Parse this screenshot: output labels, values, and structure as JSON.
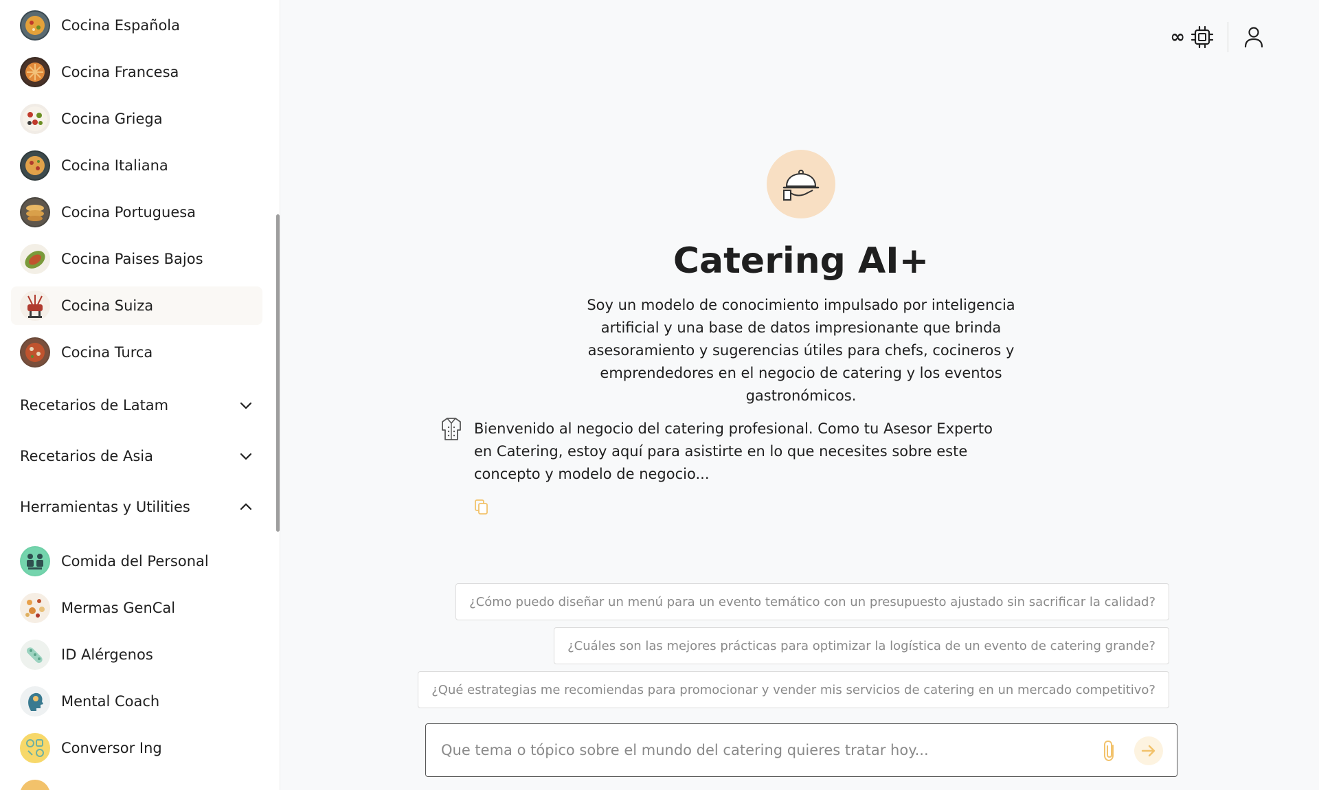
{
  "sidebar": {
    "cuisines": [
      {
        "label": "Cocina Española",
        "icon": "paella-dish-icon"
      },
      {
        "label": "Cocina Francesa",
        "icon": "tart-dish-icon"
      },
      {
        "label": "Cocina Griega",
        "icon": "greek-salad-icon"
      },
      {
        "label": "Cocina Italiana",
        "icon": "pizza-dish-icon"
      },
      {
        "label": "Cocina Portuguesa",
        "icon": "pastel-de-nata-icon"
      },
      {
        "label": "Cocina Paises Bajos",
        "icon": "dutch-dish-icon"
      },
      {
        "label": "Cocina Suiza",
        "icon": "fondue-pot-icon",
        "active": true
      },
      {
        "label": "Cocina Turca",
        "icon": "turkish-dish-icon"
      }
    ],
    "sections": [
      {
        "label": "Recetarios de Latam",
        "expanded": false
      },
      {
        "label": "Recetarios de Asia",
        "expanded": false
      },
      {
        "label": "Herramientas y Utilities",
        "expanded": true
      }
    ],
    "tools": [
      {
        "label": "Comida del Personal",
        "icon": "staff-meal-icon"
      },
      {
        "label": "Mermas GenCal",
        "icon": "waste-calculator-icon"
      },
      {
        "label": "ID Alérgenos",
        "icon": "allergen-id-icon"
      },
      {
        "label": "Mental Coach",
        "icon": "mental-coach-icon"
      },
      {
        "label": "Conversor Ing",
        "icon": "ingredient-converter-icon"
      }
    ]
  },
  "topbar": {
    "infinity_label": "∞",
    "icons": [
      "infinity-icon",
      "cpu-chip-icon",
      "user-profile-icon"
    ]
  },
  "hero": {
    "title": "Catering AI+",
    "description": "Soy un modelo de conocimiento impulsado por inteligencia artificial y una base de datos impresionante que brinda asesoramiento y sugerencias útiles para chefs, cocineros y emprendedores en el negocio de catering y los eventos gastronómicos."
  },
  "message": {
    "text": "Bienvenido al negocio del catering profesional. Como tu Asesor Experto en Catering, estoy aquí para asistirte en lo que necesites sobre este concepto y modelo de negocio..."
  },
  "suggestions": [
    "¿Cómo puedo diseñar un menú para un evento temático con un presupuesto ajustado sin sacrificar la calidad?",
    "¿Cuáles son las mejores prácticas para optimizar la logística de un evento de catering grande?",
    "¿Qué estrategias me recomiendas para promocionar y vender mis servicios de catering en un mercado competitivo?"
  ],
  "composer": {
    "placeholder": "Que tema o tópico sobre el mundo del catering quieres tratar hoy..."
  },
  "colors": {
    "accent": "#f2c26b",
    "hero_logo_bg": "#f8dfc3",
    "background": "#f8f9fa"
  }
}
